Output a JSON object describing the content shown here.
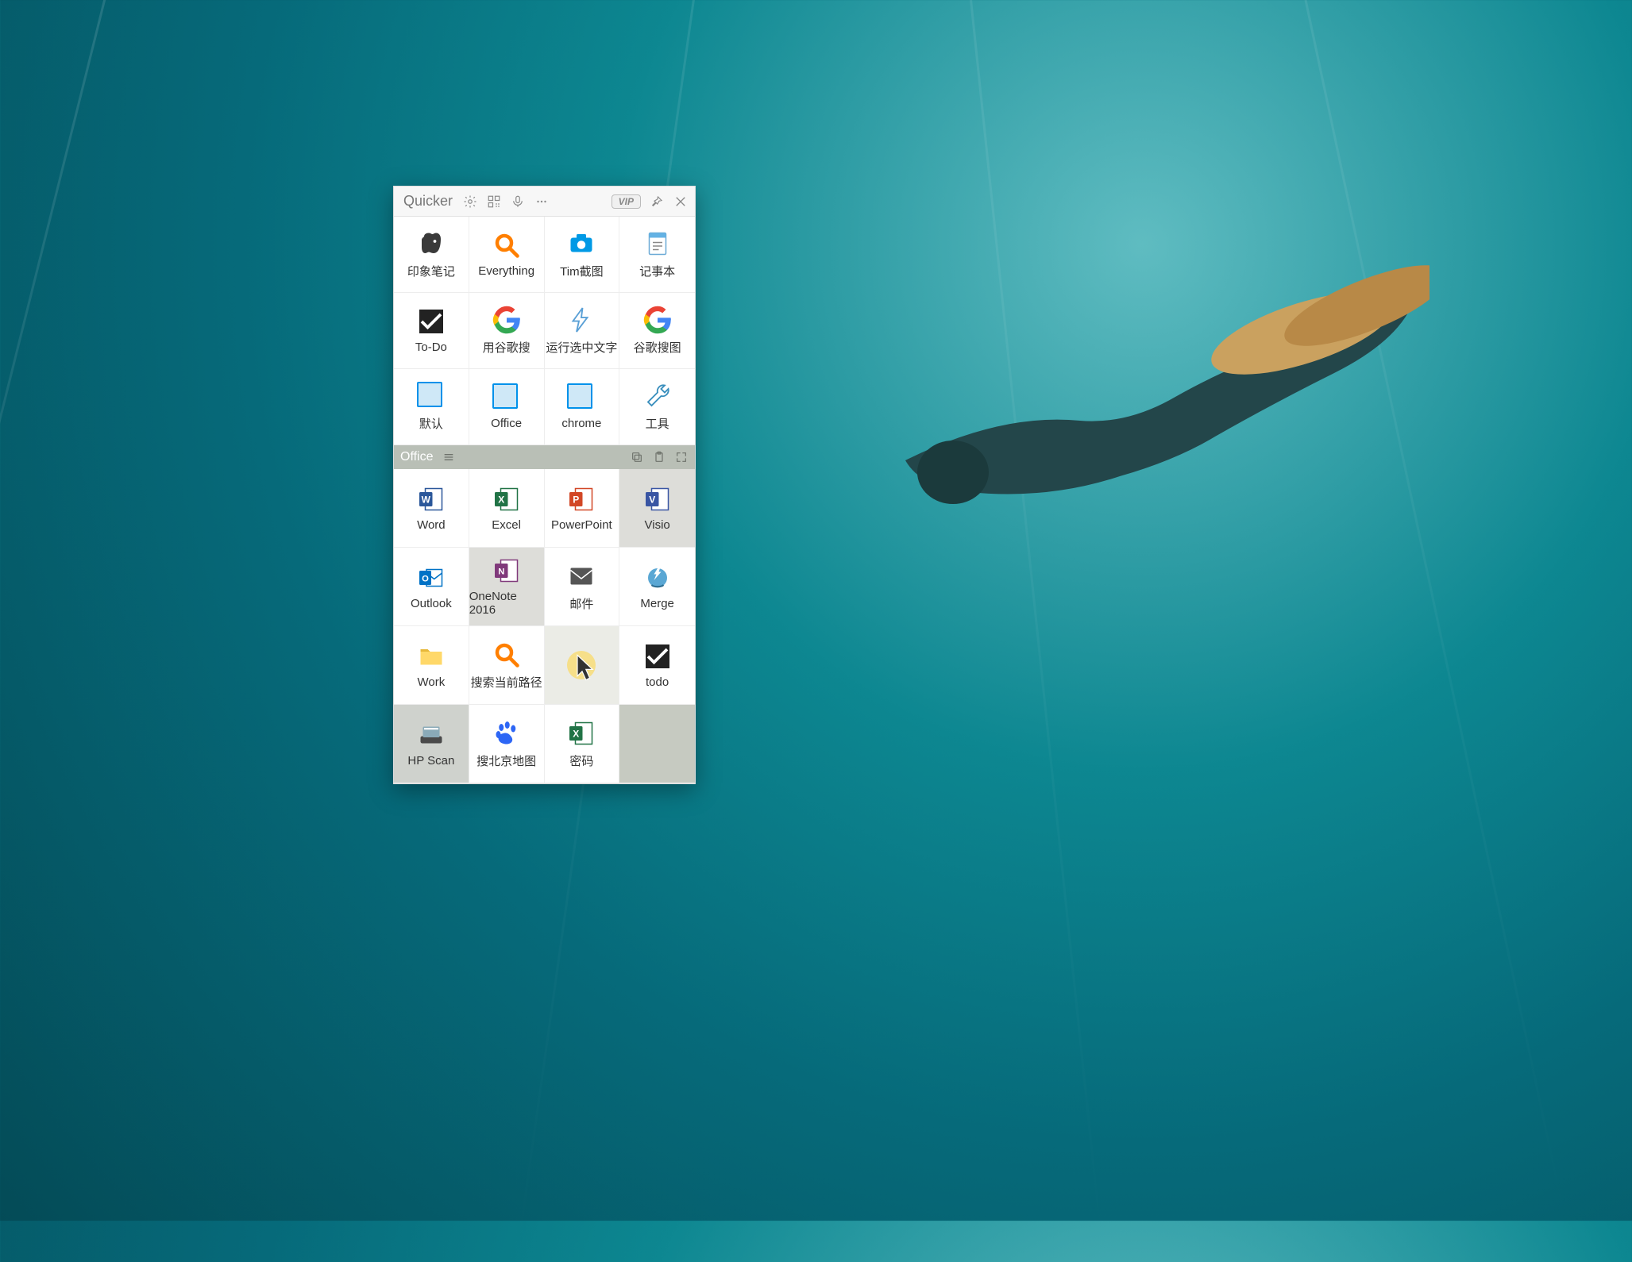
{
  "app": {
    "title": "Quicker",
    "vip_label": "VIP"
  },
  "top_grid": [
    {
      "label": "印象笔记",
      "icon": "evernote"
    },
    {
      "label": "Everything",
      "icon": "search-orange"
    },
    {
      "label": "Tim截图",
      "icon": "camera"
    },
    {
      "label": "记事本",
      "icon": "notepad"
    },
    {
      "label": "To-Do",
      "icon": "todo"
    },
    {
      "label": "用谷歌搜",
      "icon": "google"
    },
    {
      "label": "运行选中文字",
      "icon": "bolt"
    },
    {
      "label": "谷歌搜图",
      "icon": "google"
    },
    {
      "label": "默认",
      "icon": "stack"
    },
    {
      "label": "Office",
      "icon": "stack"
    },
    {
      "label": "chrome",
      "icon": "stack"
    },
    {
      "label": "工具",
      "icon": "wrench"
    }
  ],
  "section": {
    "title": "Office"
  },
  "office_grid": [
    {
      "label": "Word",
      "icon": "word",
      "bg": "w"
    },
    {
      "label": "Excel",
      "icon": "excel",
      "bg": "w"
    },
    {
      "label": "PowerPoint",
      "icon": "ppt",
      "bg": "w"
    },
    {
      "label": "Visio",
      "icon": "visio",
      "bg": "s"
    },
    {
      "label": "Outlook",
      "icon": "outlook",
      "bg": "w"
    },
    {
      "label": "OneNote 2016",
      "icon": "onenote",
      "bg": "s"
    },
    {
      "label": "邮件",
      "icon": "mail",
      "bg": "w"
    },
    {
      "label": "Merge",
      "icon": "merge",
      "bg": "w"
    },
    {
      "label": "Work",
      "icon": "folder",
      "bg": "w"
    },
    {
      "label": "搜索当前路径",
      "icon": "search-orange",
      "bg": "w"
    },
    {
      "label": "",
      "icon": "cursor-spot",
      "bg": "h"
    },
    {
      "label": "todo",
      "icon": "todo",
      "bg": "w"
    },
    {
      "label": "HP Scan",
      "icon": "scanner",
      "bg": "s"
    },
    {
      "label": "搜北京地图",
      "icon": "baidu",
      "bg": "w"
    },
    {
      "label": "密码",
      "icon": "excel",
      "bg": "w"
    },
    {
      "label": "",
      "icon": "",
      "bg": "e"
    }
  ]
}
